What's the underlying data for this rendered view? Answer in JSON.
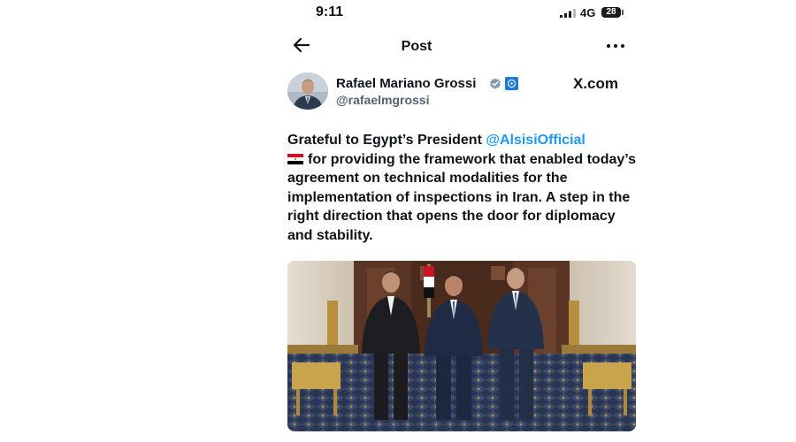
{
  "status_bar": {
    "time": "9:11",
    "network": "4G",
    "battery": "28"
  },
  "nav": {
    "title": "Post",
    "back_icon": "arrow-left-icon",
    "more_icon": "more-dots-icon"
  },
  "author": {
    "name": "Rafael Mariano Grossi",
    "handle": "@rafaelmgrossi",
    "verified": true,
    "affiliation_icon": "iaea-org-icon"
  },
  "source": "X.com",
  "tweet": {
    "text_before": "Grateful to Egypt’s President ",
    "mention": "@AlsisiOfficial",
    "flag_icon": "egypt-flag-icon",
    "text_after": "for providing the framework that enabled today’s agreement on technical modalities for the implementation of inspections in Iran. A step in the right direction that opens the door for diplomacy and stability."
  },
  "colors": {
    "link": "#1d9bf0",
    "text": "#0f1419",
    "secondary": "#536471",
    "verified": "#829aab"
  }
}
